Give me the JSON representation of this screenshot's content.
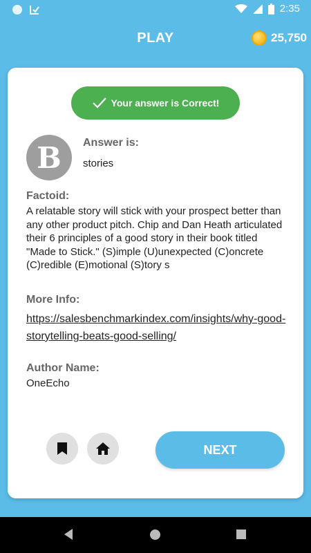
{
  "status_bar": {
    "time": "2:35"
  },
  "app_bar": {
    "title": "PLAY",
    "coins": "25,750"
  },
  "result": {
    "banner_text": "Your answer is Correct!"
  },
  "answer": {
    "avatar_letter": "B",
    "label": "Answer is:",
    "value": "stories"
  },
  "factoid": {
    "label": "Factoid:",
    "text": "A relatable story will stick with your prospect better than any other product pitch. Chip and Dan Heath articulated their 6 principles of a good story in their book titled \"Made to Stick.\" (S)imple (U)unexpected (C)oncrete (C)redible (E)motional (S)tory s"
  },
  "more_info": {
    "label": "More Info:",
    "link": "https://salesbenchmarkindex.com/insights/why-good-storytelling-beats-good-selling/"
  },
  "author": {
    "label": "Author Name:",
    "value": "OneEcho"
  },
  "actions": {
    "next_label": "NEXT"
  },
  "icons": {
    "bookmark": "bookmark-icon",
    "home": "home-icon",
    "check": "check-icon",
    "coin": "coin-icon"
  },
  "colors": {
    "background": "#5bbce8",
    "correct": "#4caf50",
    "avatar": "#9e9e9e"
  }
}
